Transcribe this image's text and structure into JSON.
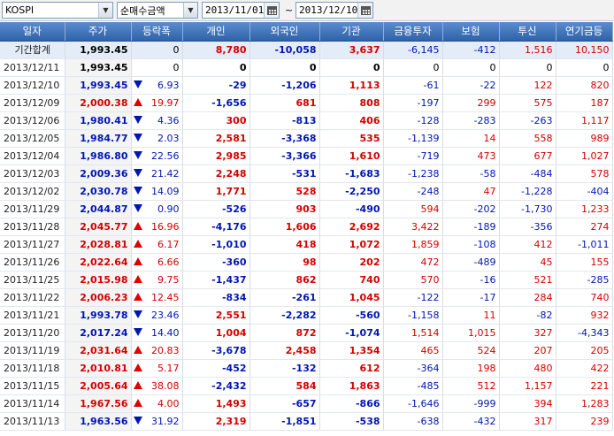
{
  "toolbar": {
    "index_select": "KOSPI",
    "type_select": "순매수금액",
    "start_date": "2013/11/01",
    "separator": "~",
    "end_date": "2013/12/10"
  },
  "columns": [
    "일자",
    "주가",
    "등락폭",
    "개인",
    "외국인",
    "기관",
    "금융투자",
    "보험",
    "투신",
    "연기금등"
  ],
  "colors": {
    "up": "#d40000",
    "down": "#0016b3",
    "header": "#3c70b8"
  },
  "rows": [
    {
      "date": "기간합계",
      "close": "1,993.45",
      "chg": "0",
      "dir": "none",
      "indiv": "8,780",
      "foreign": "-10,058",
      "inst": "3,637",
      "fin": "-6,145",
      "ins": "-412",
      "trust": "1,516",
      "pension": "10,150",
      "summary": true
    },
    {
      "date": "2013/12/11",
      "close": "1,993.45",
      "chg": "0",
      "dir": "none",
      "indiv": "0",
      "foreign": "0",
      "inst": "0",
      "fin": "0",
      "ins": "0",
      "trust": "0",
      "pension": "0"
    },
    {
      "date": "2013/12/10",
      "close": "1,993.45",
      "chg": "6.93",
      "dir": "down",
      "indiv": "-29",
      "foreign": "-1,206",
      "inst": "1,113",
      "fin": "-61",
      "ins": "-22",
      "trust": "122",
      "pension": "820"
    },
    {
      "date": "2013/12/09",
      "close": "2,000.38",
      "chg": "19.97",
      "dir": "up",
      "indiv": "-1,656",
      "foreign": "681",
      "inst": "808",
      "fin": "-197",
      "ins": "299",
      "trust": "575",
      "pension": "187"
    },
    {
      "date": "2013/12/06",
      "close": "1,980.41",
      "chg": "4.36",
      "dir": "down",
      "indiv": "300",
      "foreign": "-813",
      "inst": "406",
      "fin": "-128",
      "ins": "-283",
      "trust": "-263",
      "pension": "1,117"
    },
    {
      "date": "2013/12/05",
      "close": "1,984.77",
      "chg": "2.03",
      "dir": "down",
      "indiv": "2,581",
      "foreign": "-3,368",
      "inst": "535",
      "fin": "-1,139",
      "ins": "14",
      "trust": "558",
      "pension": "989"
    },
    {
      "date": "2013/12/04",
      "close": "1,986.80",
      "chg": "22.56",
      "dir": "down",
      "indiv": "2,985",
      "foreign": "-3,366",
      "inst": "1,610",
      "fin": "-719",
      "ins": "473",
      "trust": "677",
      "pension": "1,027"
    },
    {
      "date": "2013/12/03",
      "close": "2,009.36",
      "chg": "21.42",
      "dir": "down",
      "indiv": "2,248",
      "foreign": "-531",
      "inst": "-1,683",
      "fin": "-1,238",
      "ins": "-58",
      "trust": "-484",
      "pension": "578"
    },
    {
      "date": "2013/12/02",
      "close": "2,030.78",
      "chg": "14.09",
      "dir": "down",
      "indiv": "1,771",
      "foreign": "528",
      "inst": "-2,250",
      "fin": "-248",
      "ins": "47",
      "trust": "-1,228",
      "pension": "-404"
    },
    {
      "date": "2013/11/29",
      "close": "2,044.87",
      "chg": "0.90",
      "dir": "down",
      "indiv": "-526",
      "foreign": "903",
      "inst": "-490",
      "fin": "594",
      "ins": "-202",
      "trust": "-1,730",
      "pension": "1,233"
    },
    {
      "date": "2013/11/28",
      "close": "2,045.77",
      "chg": "16.96",
      "dir": "up",
      "indiv": "-4,176",
      "foreign": "1,606",
      "inst": "2,692",
      "fin": "3,422",
      "ins": "-189",
      "trust": "-356",
      "pension": "274"
    },
    {
      "date": "2013/11/27",
      "close": "2,028.81",
      "chg": "6.17",
      "dir": "up",
      "indiv": "-1,010",
      "foreign": "418",
      "inst": "1,072",
      "fin": "1,859",
      "ins": "-108",
      "trust": "412",
      "pension": "-1,011"
    },
    {
      "date": "2013/11/26",
      "close": "2,022.64",
      "chg": "6.66",
      "dir": "up",
      "indiv": "-360",
      "foreign": "98",
      "inst": "202",
      "fin": "472",
      "ins": "-489",
      "trust": "45",
      "pension": "155"
    },
    {
      "date": "2013/11/25",
      "close": "2,015.98",
      "chg": "9.75",
      "dir": "up",
      "indiv": "-1,437",
      "foreign": "862",
      "inst": "740",
      "fin": "570",
      "ins": "-16",
      "trust": "521",
      "pension": "-285"
    },
    {
      "date": "2013/11/22",
      "close": "2,006.23",
      "chg": "12.45",
      "dir": "up",
      "indiv": "-834",
      "foreign": "-261",
      "inst": "1,045",
      "fin": "-122",
      "ins": "-17",
      "trust": "284",
      "pension": "740"
    },
    {
      "date": "2013/11/21",
      "close": "1,993.78",
      "chg": "23.46",
      "dir": "down",
      "indiv": "2,551",
      "foreign": "-2,282",
      "inst": "-560",
      "fin": "-1,158",
      "ins": "11",
      "trust": "-82",
      "pension": "932"
    },
    {
      "date": "2013/11/20",
      "close": "2,017.24",
      "chg": "14.40",
      "dir": "down",
      "indiv": "1,004",
      "foreign": "872",
      "inst": "-1,074",
      "fin": "1,514",
      "ins": "1,015",
      "trust": "327",
      "pension": "-4,343"
    },
    {
      "date": "2013/11/19",
      "close": "2,031.64",
      "chg": "20.83",
      "dir": "up",
      "indiv": "-3,678",
      "foreign": "2,458",
      "inst": "1,354",
      "fin": "465",
      "ins": "524",
      "trust": "207",
      "pension": "205"
    },
    {
      "date": "2013/11/18",
      "close": "2,010.81",
      "chg": "5.17",
      "dir": "up",
      "indiv": "-452",
      "foreign": "-132",
      "inst": "612",
      "fin": "-364",
      "ins": "198",
      "trust": "480",
      "pension": "422"
    },
    {
      "date": "2013/11/15",
      "close": "2,005.64",
      "chg": "38.08",
      "dir": "up",
      "indiv": "-2,432",
      "foreign": "584",
      "inst": "1,863",
      "fin": "-485",
      "ins": "512",
      "trust": "1,157",
      "pension": "221"
    },
    {
      "date": "2013/11/14",
      "close": "1,967.56",
      "chg": "4.00",
      "dir": "up",
      "indiv": "1,493",
      "foreign": "-657",
      "inst": "-866",
      "fin": "-1,646",
      "ins": "-999",
      "trust": "394",
      "pension": "1,283"
    },
    {
      "date": "2013/11/13",
      "close": "1,963.56",
      "chg": "31.92",
      "dir": "down",
      "indiv": "2,319",
      "foreign": "-1,851",
      "inst": "-538",
      "fin": "-638",
      "ins": "-432",
      "trust": "317",
      "pension": "239"
    }
  ]
}
